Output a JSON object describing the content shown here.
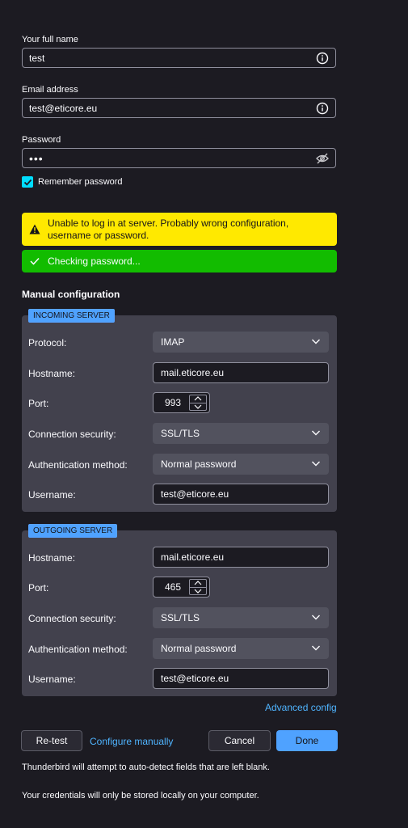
{
  "identity": {
    "name_label": "Your full name",
    "name_value": "test",
    "email_label": "Email address",
    "email_value": "test@eticore.eu",
    "password_label": "Password",
    "password_value": "•••",
    "remember_label": "Remember password",
    "remember_checked": true
  },
  "banners": {
    "error_text": "Unable to log in at server. Probably wrong configuration, username or password.",
    "success_text": "Checking password..."
  },
  "manual": {
    "heading": "Manual configuration",
    "incoming": {
      "legend": "INCOMING SERVER",
      "protocol_label": "Protocol:",
      "protocol_value": "IMAP",
      "hostname_label": "Hostname:",
      "hostname_value": "mail.eticore.eu",
      "port_label": "Port:",
      "port_value": "993",
      "security_label": "Connection security:",
      "security_value": "SSL/TLS",
      "auth_label": "Authentication method:",
      "auth_value": "Normal password",
      "username_label": "Username:",
      "username_value": "test@eticore.eu"
    },
    "outgoing": {
      "legend": "OUTGOING SERVER",
      "hostname_label": "Hostname:",
      "hostname_value": "mail.eticore.eu",
      "port_label": "Port:",
      "port_value": "465",
      "security_label": "Connection security:",
      "security_value": "SSL/TLS",
      "auth_label": "Authentication method:",
      "auth_value": "Normal password",
      "username_label": "Username:",
      "username_value": "test@eticore.eu"
    },
    "advanced_link": "Advanced config"
  },
  "buttons": {
    "retest": "Re-test",
    "configure_manually": "Configure manually",
    "cancel": "Cancel",
    "done": "Done"
  },
  "notes": {
    "autodetect": "Thunderbird will attempt to auto-detect fields that are left blank.",
    "credentials": "Your credentials will only be stored locally on your computer."
  },
  "colors": {
    "background": "#1c1b22",
    "error_banner": "#ffe900",
    "success_banner": "#12bc00",
    "fieldset_bg": "#42414d",
    "accent": "#00ddff",
    "primary_button": "#4fa2ff"
  },
  "icons": {
    "name_info": "info-icon",
    "email_info": "info-icon",
    "password_toggle": "eye-slash-icon",
    "warning": "warning-icon",
    "check": "check-icon",
    "dropdown": "chevron-down-icon"
  }
}
